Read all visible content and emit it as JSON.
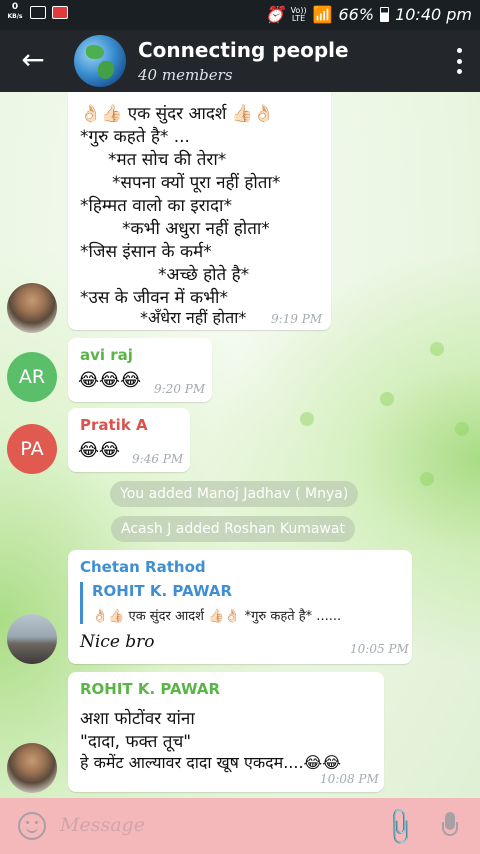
{
  "status_bar": {
    "net_speed_value": "0",
    "net_speed_unit": "KB/s",
    "volte_top": "Vo))",
    "volte_bottom": "LTE",
    "battery": "66%",
    "time": "10:40 pm"
  },
  "header": {
    "title": "Connecting people",
    "subtitle": "40 members"
  },
  "messages": [
    {
      "lines": [
        "👌🏻👍🏻 एक सुंदर आदर्श  👍🏻👌🏻",
        "*गुरु कहते है* ...",
        "*मत सोच की तेरा*",
        "*सपना क्यों पूरा नहीं होता*",
        "*हिम्मत वालो का इरादा*",
        "*कभी अधुरा नहीं होता*",
        "*जिस इंसान के कर्म*",
        "*अच्छे होते है*",
        "*उस के जीवन में कभी*",
        "*अँधेरा नहीं होता*"
      ],
      "time": "9:19 PM"
    },
    {
      "avatar_initials": "AR",
      "avatar_color": "#5bbf6a",
      "sender": "avi raj",
      "sender_color": "#5bb546",
      "text": "😂😂😂",
      "time": "9:20 PM"
    },
    {
      "avatar_initials": "PA",
      "avatar_color": "#e05a4f",
      "sender": "Pratik A",
      "sender_color": "#d9534f",
      "text": "😂😂",
      "time": "9:46 PM"
    },
    {
      "sender": "Chetan Rathod",
      "sender_color": "#3f8fd2",
      "reply_to": "ROHIT K. PAWAR",
      "reply_text": "👌🏻👍🏻 एक सुंदर आदर्श  👍🏻👌🏻 *गुरु कहते है* ......",
      "text": "Nice bro",
      "time": "10:05 PM"
    },
    {
      "sender": "ROHIT K. PAWAR",
      "sender_color": "#5bb546",
      "lines": [
        "अशा फोटोंवर यांना",
        "\"दादा, फक्त तूच\"",
        "हे कमेंट आल्यावर दादा खूष एकदम....😂😂"
      ],
      "time": "10:08 PM"
    }
  ],
  "service_messages": [
    "You added Manoj Jadhav ( Mnya)",
    "Acash J added Roshan Kumawat"
  ],
  "input": {
    "placeholder": "Message"
  }
}
